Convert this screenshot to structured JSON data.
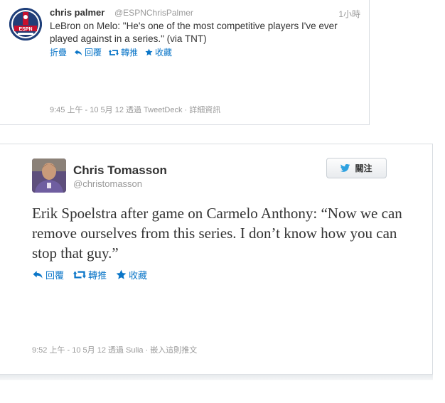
{
  "tweet1": {
    "name": "chris palmer",
    "handle": "@ESPNChrisPalmer",
    "time": "1小時",
    "avatar": "espn-nba-logo",
    "text": "LeBron on Melo: \"He's one of the most competitive players I've ever played against in a series.\" (via TNT)",
    "actions": {
      "collapse": "折疊",
      "reply": "回覆",
      "retweet": "轉推",
      "favorite": "收藏"
    },
    "meta": "9:45 上午 - 10 5月 12 透過 TweetDeck · 詳細資訊"
  },
  "tweet2": {
    "name": "Chris Tomasson",
    "handle": "@christomasson",
    "follow_label": "關注",
    "text": "Erik Spoelstra after game on Carmelo Anthony: “Now we can remove ourselves from this series. I don’t know how you can stop that guy.”",
    "actions": {
      "reply": "回覆",
      "retweet": "轉推",
      "favorite": "收藏"
    },
    "meta": "9:52 上午 - 10 5月 12 透過 Sulia · 嵌入這則推文"
  },
  "colors": {
    "link": "#0b76c8",
    "muted": "#999999",
    "text": "#333333",
    "twitter_bird": "#2ea1e0"
  }
}
